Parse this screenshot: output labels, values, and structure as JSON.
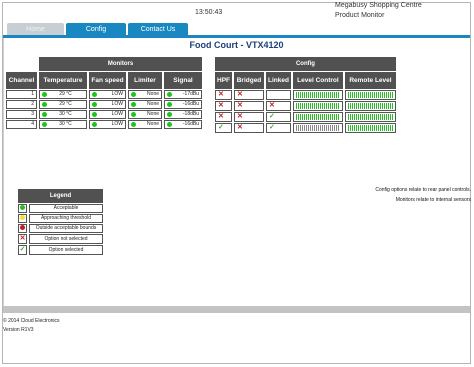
{
  "header": {
    "time": "13:50:43",
    "venue": "Megabusy Shopping Centre",
    "app": "Product Monitor"
  },
  "tabs": [
    {
      "label": "Home"
    },
    {
      "label": "Config"
    },
    {
      "label": "Contact Us"
    }
  ],
  "device_title": "Food Court - VTX4120",
  "monitors": {
    "group_title": "Monitors",
    "columns": [
      "Channel",
      "Temperature",
      "Fan speed",
      "Limiter",
      "Signal"
    ],
    "rows": [
      {
        "channel": "1",
        "temperature": "29 °C",
        "fan": "LOW",
        "limiter": "None",
        "signal": "-17dBu"
      },
      {
        "channel": "2",
        "temperature": "29 °C",
        "fan": "LOW",
        "limiter": "None",
        "signal": "-16dBu"
      },
      {
        "channel": "3",
        "temperature": "30 °C",
        "fan": "LOW",
        "limiter": "None",
        "signal": "-18dBu"
      },
      {
        "channel": "4",
        "temperature": "30 °C",
        "fan": "LOW",
        "limiter": "None",
        "signal": "-16dBu"
      }
    ]
  },
  "config": {
    "group_title": "Config",
    "columns": [
      "HPF",
      "Bridged",
      "Linked",
      "Level Control",
      "Remote Level"
    ],
    "rows": [
      {
        "hpf": "x",
        "bridged": "x",
        "linked": ""
      },
      {
        "hpf": "x",
        "bridged": "x",
        "linked": "x"
      },
      {
        "hpf": "x",
        "bridged": "x",
        "linked": "check"
      },
      {
        "hpf": "check",
        "bridged": "x",
        "linked": "check"
      }
    ]
  },
  "legend": {
    "title": "Legend",
    "items": [
      {
        "icon": "green-dot-icon",
        "label": "Acceptable"
      },
      {
        "icon": "yellow-dot-icon",
        "label": "Approaching threshold"
      },
      {
        "icon": "red-dot-icon",
        "label": "Outside acceptable bounds"
      },
      {
        "icon": "cross-icon",
        "label": "Option not selected"
      },
      {
        "icon": "check-icon",
        "label": "Option selected"
      }
    ]
  },
  "notes": {
    "line1": "Config options relate to rear panel controls.",
    "line2": "Monitors relate to internal sensors"
  },
  "footer": {
    "copyright": "© 2014 Cloud Electronics",
    "version": "Version R1V3"
  },
  "colors": {
    "tab_active": "#1a88c0",
    "tab_home": "#c8cfd4",
    "header_bg": "#515151",
    "title": "#1d3f7a",
    "ok": "#1fc31f",
    "warn": "#f1e12d",
    "bad": "#c91818",
    "check": "#3fb02a"
  }
}
